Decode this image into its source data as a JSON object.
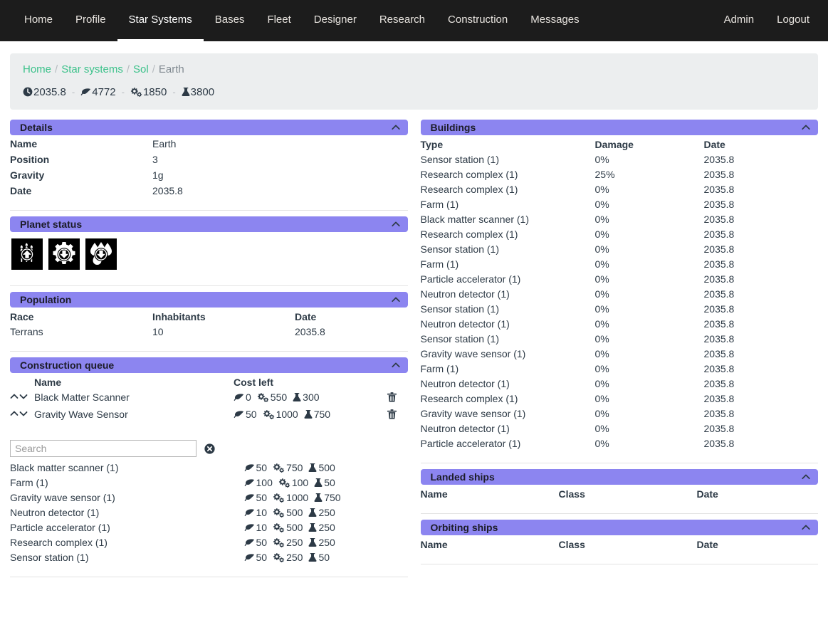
{
  "nav": {
    "left_items": [
      {
        "label": "Home",
        "active": false
      },
      {
        "label": "Profile",
        "active": false
      },
      {
        "label": "Star Systems",
        "active": true
      },
      {
        "label": "Bases",
        "active": false
      },
      {
        "label": "Fleet",
        "active": false
      },
      {
        "label": "Designer",
        "active": false
      },
      {
        "label": "Research",
        "active": false
      },
      {
        "label": "Construction",
        "active": false
      },
      {
        "label": "Messages",
        "active": false
      }
    ],
    "right_items": [
      {
        "label": "Admin"
      },
      {
        "label": "Logout"
      }
    ]
  },
  "breadcrumb": {
    "items": [
      {
        "label": "Home",
        "link": true
      },
      {
        "label": "Star systems",
        "link": true
      },
      {
        "label": "Sol",
        "link": true
      },
      {
        "label": "Earth",
        "link": false
      }
    ],
    "separator": "/"
  },
  "resources": {
    "separator": "-",
    "items": [
      {
        "icon": "clock-icon",
        "value": "2035.8"
      },
      {
        "icon": "leaf-icon",
        "value": "4772"
      },
      {
        "icon": "cogs-icon",
        "value": "1850"
      },
      {
        "icon": "flask-icon",
        "value": "3800"
      }
    ]
  },
  "details": {
    "title": "Details",
    "rows": [
      {
        "key": "Name",
        "value": "Earth"
      },
      {
        "key": "Position",
        "value": "3"
      },
      {
        "key": "Gravity",
        "value": "1g"
      },
      {
        "key": "Date",
        "value": "2035.8"
      }
    ]
  },
  "planet_status": {
    "title": "Planet status",
    "icons": [
      {
        "name": "food-increase-icon",
        "glyph": "wheat",
        "trend": "up"
      },
      {
        "name": "production-decrease-icon",
        "glyph": "gear",
        "trend": "down"
      },
      {
        "name": "water-decrease-icon",
        "glyph": "water",
        "trend": "down"
      }
    ]
  },
  "population": {
    "title": "Population",
    "headers": [
      "Race",
      "Inhabitants",
      "Date"
    ],
    "rows": [
      [
        "Terrans",
        "10",
        "2035.8"
      ]
    ]
  },
  "construction_queue": {
    "title": "Construction queue",
    "headers": {
      "arrows": "",
      "name": "Name",
      "cost": "Cost left",
      "delete": ""
    },
    "rows": [
      {
        "name": "Black Matter Scanner",
        "leaf": "0",
        "cogs": "550",
        "flask": "300"
      },
      {
        "name": "Gravity Wave Sensor",
        "leaf": "50",
        "cogs": "1000",
        "flask": "750"
      }
    ]
  },
  "search": {
    "placeholder": "Search",
    "value": "",
    "clear_icon": "clear-circle-icon"
  },
  "buildable": {
    "rows": [
      {
        "name": "Black matter scanner (1)",
        "leaf": "50",
        "cogs": "750",
        "flask": "500"
      },
      {
        "name": "Farm (1)",
        "leaf": "100",
        "cogs": "100",
        "flask": "50"
      },
      {
        "name": "Gravity wave sensor (1)",
        "leaf": "50",
        "cogs": "1000",
        "flask": "750"
      },
      {
        "name": "Neutron detector (1)",
        "leaf": "10",
        "cogs": "500",
        "flask": "250"
      },
      {
        "name": "Particle accelerator (1)",
        "leaf": "10",
        "cogs": "500",
        "flask": "250"
      },
      {
        "name": "Research complex (1)",
        "leaf": "50",
        "cogs": "250",
        "flask": "250"
      },
      {
        "name": "Sensor station (1)",
        "leaf": "50",
        "cogs": "250",
        "flask": "50"
      }
    ]
  },
  "buildings": {
    "title": "Buildings",
    "headers": [
      "Type",
      "Damage",
      "Date"
    ],
    "rows": [
      [
        "Sensor station (1)",
        "0%",
        "2035.8"
      ],
      [
        "Research complex (1)",
        "25%",
        "2035.8"
      ],
      [
        "Research complex (1)",
        "0%",
        "2035.8"
      ],
      [
        "Farm (1)",
        "0%",
        "2035.8"
      ],
      [
        "Black matter scanner (1)",
        "0%",
        "2035.8"
      ],
      [
        "Research complex (1)",
        "0%",
        "2035.8"
      ],
      [
        "Sensor station (1)",
        "0%",
        "2035.8"
      ],
      [
        "Farm (1)",
        "0%",
        "2035.8"
      ],
      [
        "Particle accelerator (1)",
        "0%",
        "2035.8"
      ],
      [
        "Neutron detector (1)",
        "0%",
        "2035.8"
      ],
      [
        "Sensor station (1)",
        "0%",
        "2035.8"
      ],
      [
        "Neutron detector (1)",
        "0%",
        "2035.8"
      ],
      [
        "Sensor station (1)",
        "0%",
        "2035.8"
      ],
      [
        "Gravity wave sensor (1)",
        "0%",
        "2035.8"
      ],
      [
        "Farm (1)",
        "0%",
        "2035.8"
      ],
      [
        "Neutron detector (1)",
        "0%",
        "2035.8"
      ],
      [
        "Research complex (1)",
        "0%",
        "2035.8"
      ],
      [
        "Gravity wave sensor (1)",
        "0%",
        "2035.8"
      ],
      [
        "Neutron detector (1)",
        "0%",
        "2035.8"
      ],
      [
        "Particle accelerator (1)",
        "0%",
        "2035.8"
      ]
    ]
  },
  "landed_ships": {
    "title": "Landed ships",
    "headers": [
      "Name",
      "Class",
      "Date"
    ],
    "rows": []
  },
  "orbiting_ships": {
    "title": "Orbiting ships",
    "headers": [
      "Name",
      "Class",
      "Date"
    ],
    "rows": []
  },
  "colors": {
    "navbar_bg": "#1c1c1c",
    "panel_header": "#8c85f0",
    "breadcrumb_link": "#3dc28b",
    "jumbotron_bg": "#eceeef",
    "text": "#2d3a46"
  }
}
